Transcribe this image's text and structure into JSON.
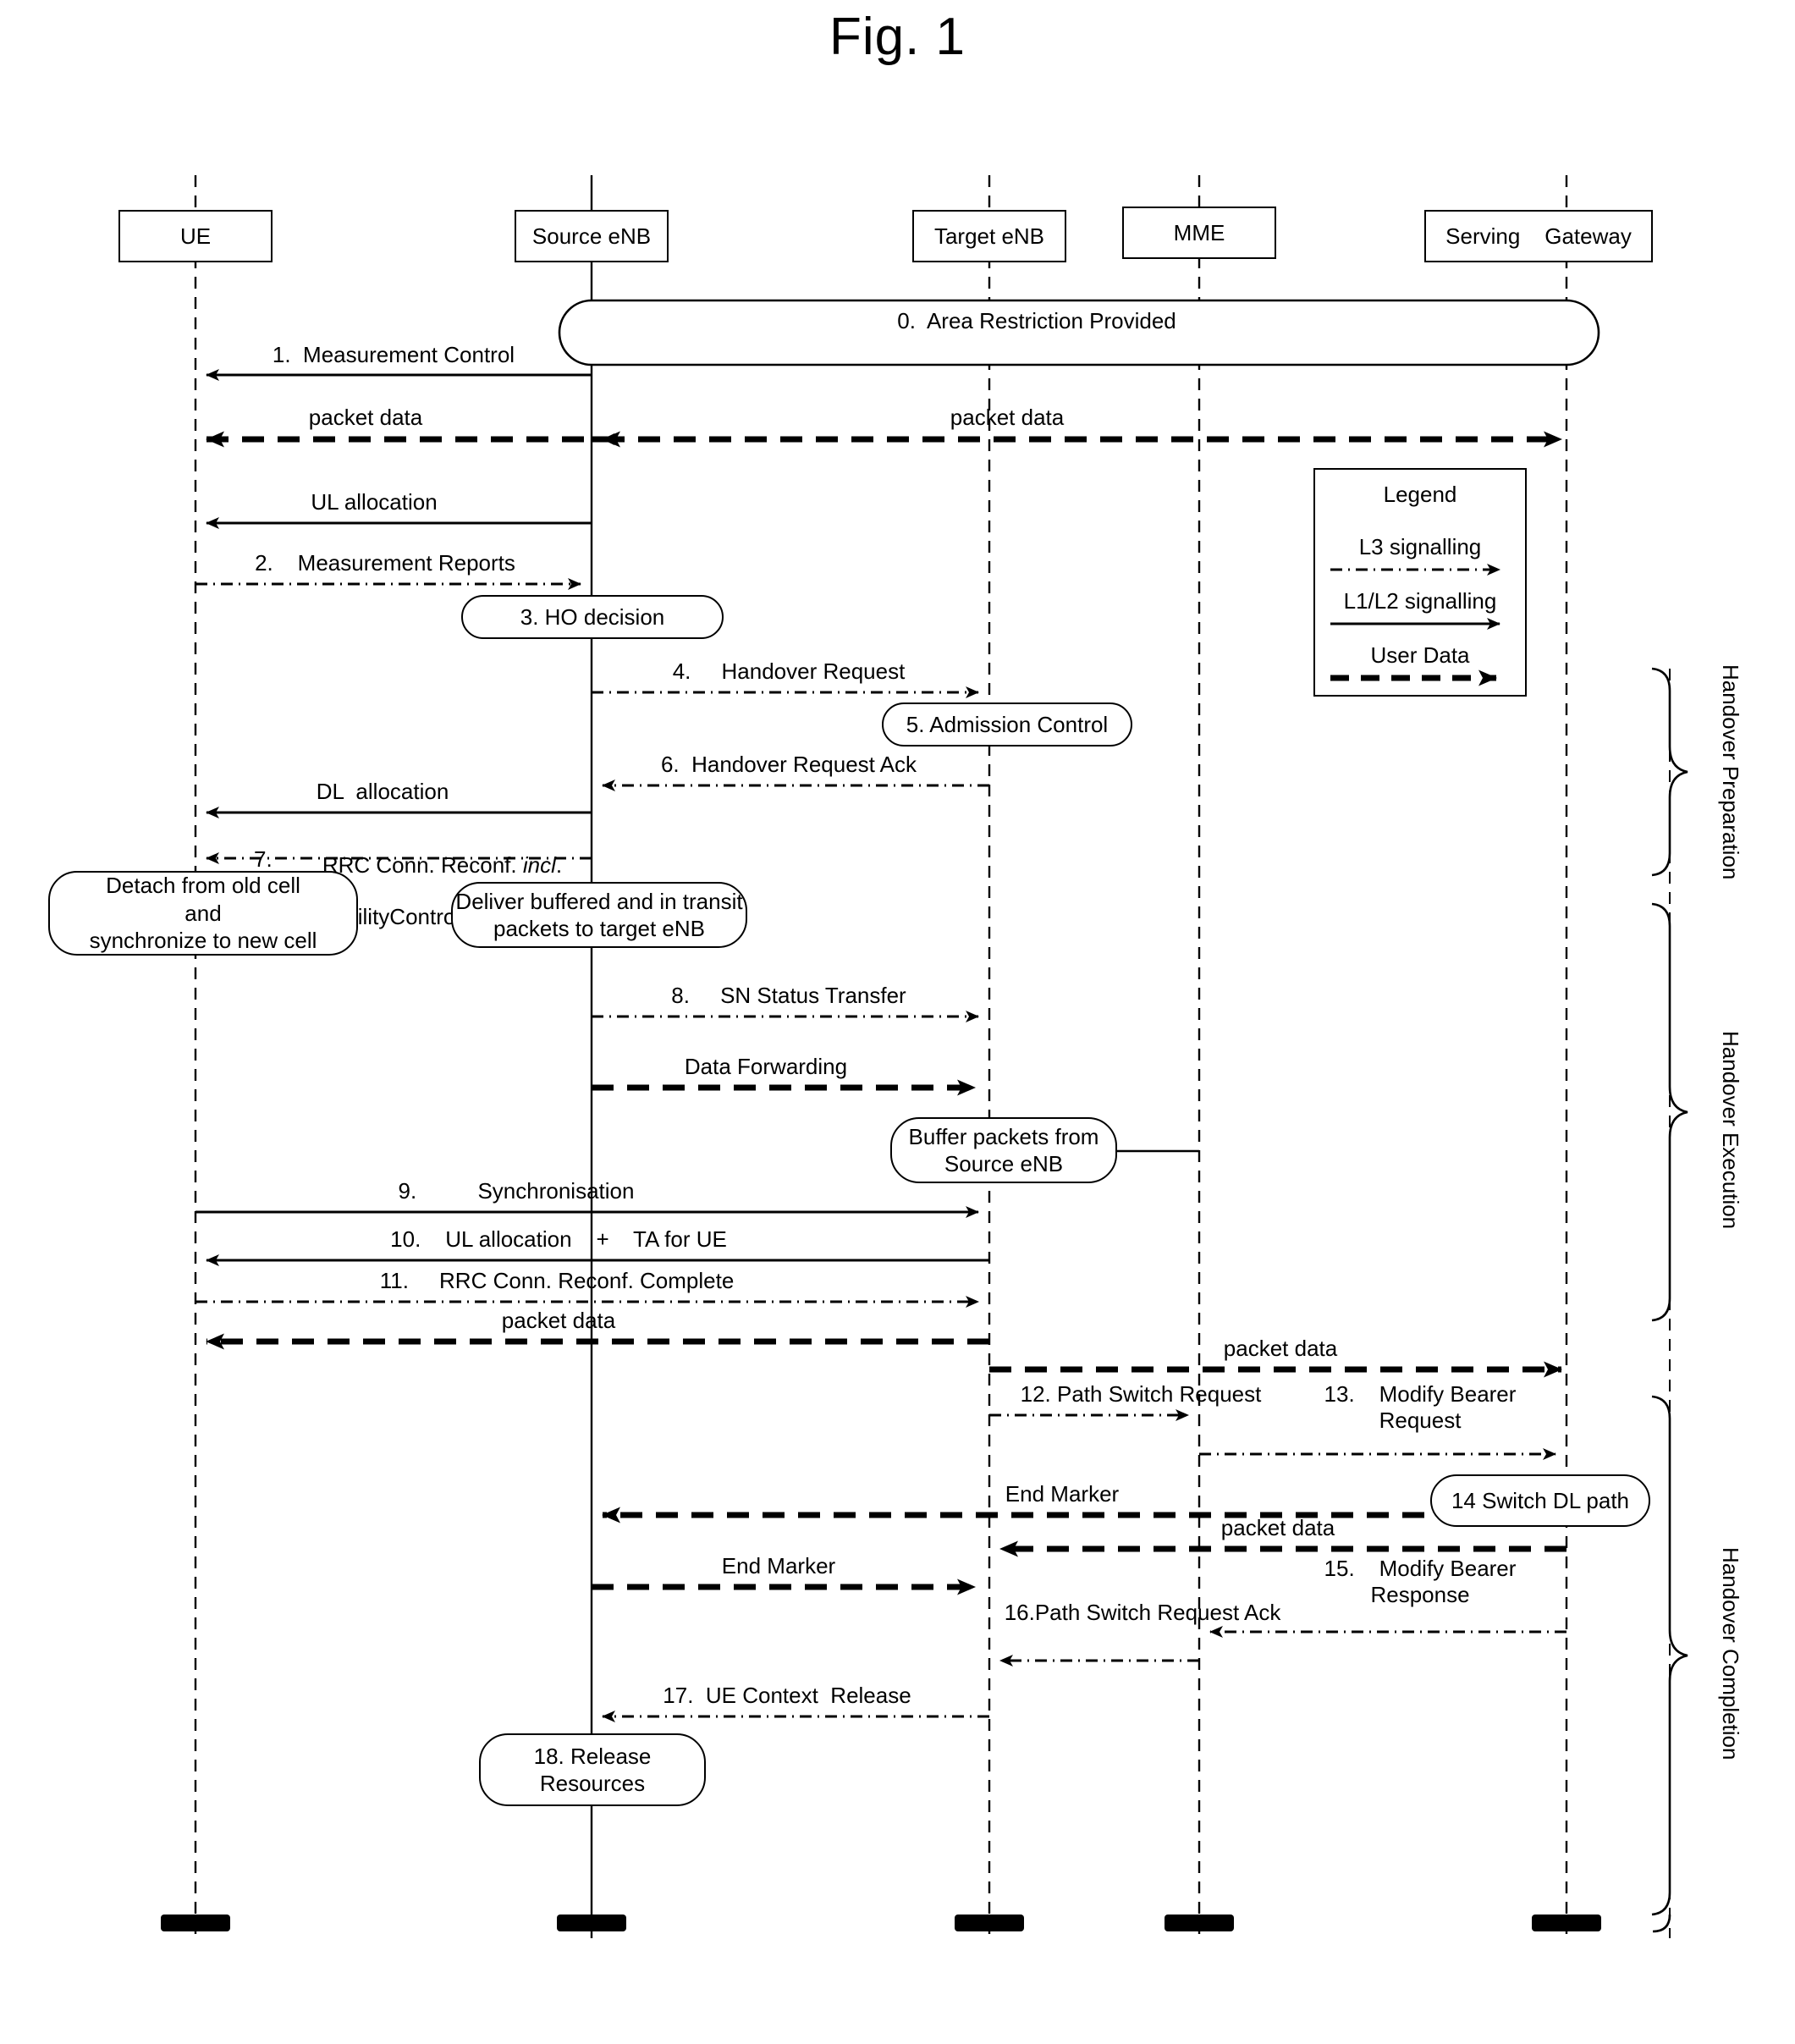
{
  "figure": {
    "title": "Fig. 1"
  },
  "lifelines": [
    {
      "name": "UE",
      "label": "UE"
    },
    {
      "name": "source-enb",
      "label": "Source eNB"
    },
    {
      "name": "target-enb",
      "label": "Target eNB"
    },
    {
      "name": "mme",
      "label": "MME"
    },
    {
      "name": "serving-gateway",
      "label": "Serving    Gateway"
    }
  ],
  "messages": {
    "m0": "0.  Area Restriction Provided",
    "m1": "1.  Measurement Control",
    "pd1_left": "packet data",
    "pd1_right": "packet data",
    "ul_alloc": "UL allocation",
    "m2": "2.    Measurement Reports",
    "m4": "4.     Handover Request",
    "m6": "6.  Handover Request Ack",
    "dl_alloc": "DL  allocation",
    "m7_num": "7.",
    "m7_l1_a": "RRC Conn",
    "m7_l1_b": ". Reconf",
    "m7_l1_c": ". ",
    "m7_l1_d": "incl",
    "m7_l1_e": ".",
    "m7_l2": "mobilityControlinformation",
    "m8": "8.     SN Status Transfer",
    "data_forwarding": "Data Forwarding",
    "m9": "9.          Synchronisation",
    "m10": "10.    UL allocation    +    TA for UE",
    "m11": "11.     RRC Conn. Reconf. Complete",
    "pd2": "packet data",
    "pd3": "packet data",
    "m12": "12. Path Switch Request",
    "m13": "13.    Modify Bearer\nRequest",
    "end_marker_1": "End Marker",
    "pd4": "packet data",
    "end_marker_2": "End Marker",
    "m15": "15.    Modify Bearer\nResponse",
    "m16": "16.Path Switch Request Ack",
    "m17": "17.  UE Context  Release"
  },
  "notes": {
    "n3": "3.  HO decision",
    "n5": "5.   Admission Control",
    "n_detach": "Detach from old cell\nand\nsynchronize to new cell",
    "n_deliver": "Deliver buffered and in transit\npackets to target eNB",
    "n_buffer": "Buffer packets from\nSource eNB",
    "n14": "14    Switch DL path",
    "n18": "18. Release\nResources"
  },
  "legend": {
    "title": "Legend",
    "items": [
      {
        "label": "L3 signalling",
        "style": "dash-dot-thin"
      },
      {
        "label": "L1/L2    signalling",
        "style": "solid-thin"
      },
      {
        "label": "User Data",
        "style": "dashed-thick"
      }
    ]
  },
  "phases": [
    {
      "label": "Handover Preparation"
    },
    {
      "label": "Handover Execution"
    },
    {
      "label": "Handover Completion"
    }
  ],
  "colors": {
    "line": "#000000",
    "background": "#ffffff"
  }
}
